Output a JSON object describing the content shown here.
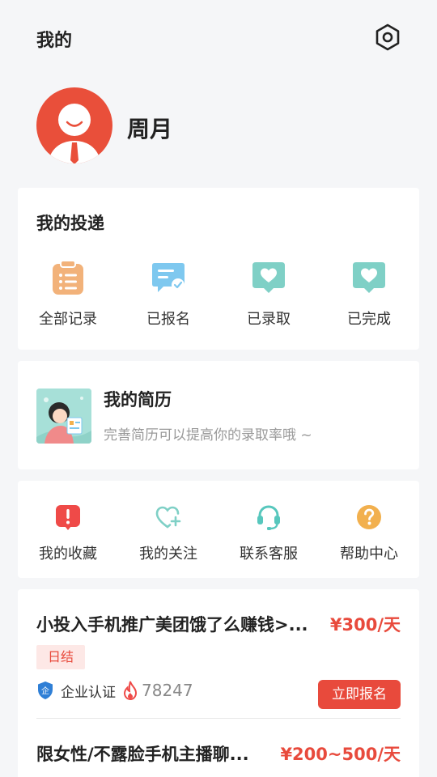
{
  "header": {
    "title": "我的",
    "settings_icon": "settings-hexagon-icon"
  },
  "profile": {
    "name": "周月",
    "avatar_icon": "avatar-icon"
  },
  "deliveries": {
    "title": "我的投递",
    "items": [
      {
        "label": "全部记录",
        "icon": "clipboard-icon",
        "color": "#f2b27a"
      },
      {
        "label": "已报名",
        "icon": "chat-check-icon",
        "color": "#7ec8ef"
      },
      {
        "label": "已录取",
        "icon": "heart-bubble-icon",
        "color": "#7fd0c6"
      },
      {
        "label": "已完成",
        "icon": "heart-bubble-icon",
        "color": "#7fd0c6"
      }
    ]
  },
  "resume": {
    "title": "我的简历",
    "subtitle": "完善简历可以提高你的录取率哦 ~"
  },
  "services": {
    "items": [
      {
        "label": "我的收藏",
        "icon": "exclamation-badge-icon",
        "color": "#ef4a48"
      },
      {
        "label": "我的关注",
        "icon": "heart-plus-icon",
        "color": "#7fd0c6"
      },
      {
        "label": "联系客服",
        "icon": "headset-icon",
        "color": "#57c7bd"
      },
      {
        "label": "帮助中心",
        "icon": "question-icon",
        "color": "#f2b04e"
      }
    ]
  },
  "jobs": [
    {
      "title": "小投入手机推广美团饿了么赚钱>...",
      "pay": "¥300/天",
      "tag": "日结",
      "cert_label": "企业认证",
      "views": "78247",
      "apply_label": "立即报名"
    },
    {
      "title": "限女性/不露脸手机主播聊...",
      "pay": "¥200~500/天"
    }
  ],
  "colors": {
    "accent": "#e84a3c",
    "avatar_bg": "#e94f3a",
    "text": "#222222",
    "subtext": "#999999",
    "tag_bg": "#fde8e6"
  }
}
